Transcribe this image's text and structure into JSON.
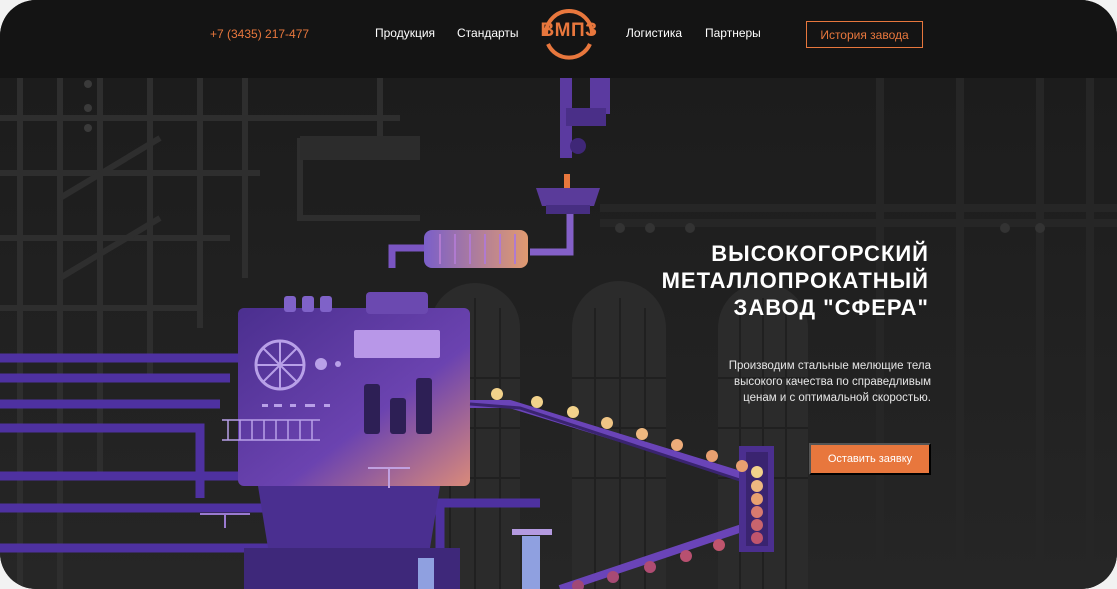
{
  "header": {
    "phone": "+7 (3435) 217-477",
    "nav": [
      "Продукция",
      "Стандарты",
      "Логистика",
      "Партнеры"
    ],
    "logo_text": "ВМПЗ",
    "history_button": "История завода"
  },
  "hero": {
    "headline": "ВЫСОКОГОРСКИЙ\nМЕТАЛЛОПРОКАТНЫЙ\nЗАВОД \"СФЕРА\"",
    "subtitle": "Производим стальные мелющие тела\nвысокого качества по справедливым\nценам и с оптимальной скоростью.",
    "cta_button": "Оставить заявку"
  },
  "colors": {
    "accent": "#e8773d",
    "header_bg": "#141414",
    "hero_bg": "#1f1f1f",
    "machine_purple": "#5b3aa0",
    "ball_colors": [
      "#f2d28b",
      "#e8a070",
      "#c0556d"
    ]
  }
}
